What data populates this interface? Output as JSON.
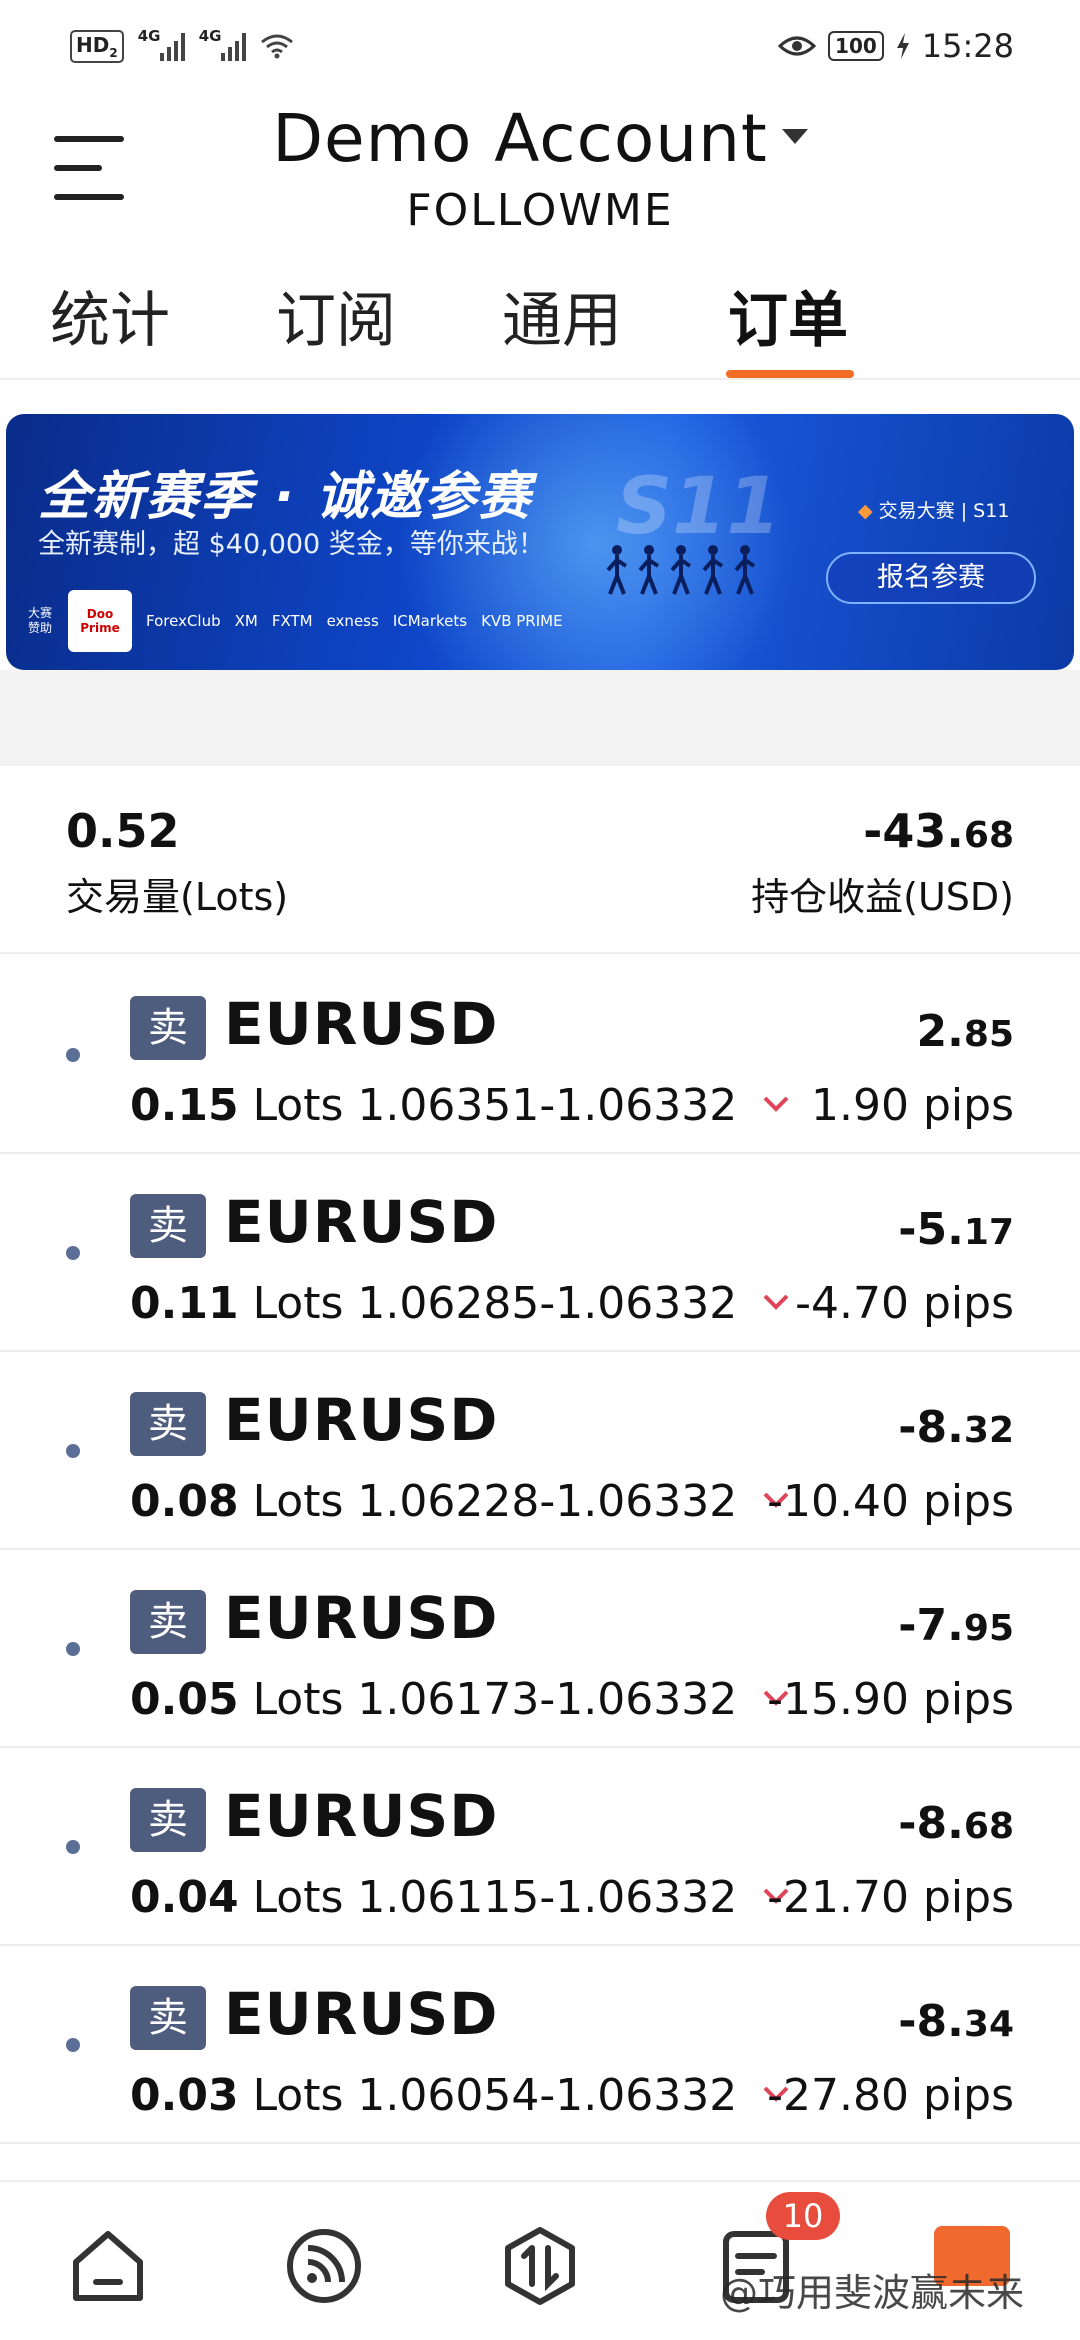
{
  "status_bar": {
    "hd": "HD",
    "hd_sub": "2",
    "network1": "4G",
    "network2": "4G",
    "battery": "100",
    "time": "15:28"
  },
  "header": {
    "account_title": "Demo Account",
    "account_sub": "FOLLOWME"
  },
  "tabs": [
    "统计",
    "订阅",
    "通用",
    "订单"
  ],
  "active_tab_index": 3,
  "banner": {
    "title": "全新赛季 · 诚邀参赛",
    "subtitle": "全新赛制，超 $40,000 奖金，等你来战！",
    "season": "S11",
    "brand": "交易大赛",
    "brand_season": "S11",
    "cta": "报名参赛",
    "sponsor_label": "大赛赞助",
    "sponsors": [
      "Doo Prime",
      "ForexClub",
      "XM",
      "FXTM",
      "exness",
      "ICMarkets",
      "KVB PRIME"
    ]
  },
  "summary": {
    "volume_value": "0.52",
    "volume_label": "交易量(Lots)",
    "pl_int": "-43.",
    "pl_dec": "68",
    "pl_label": "持仓收益(USD)"
  },
  "orders": [
    {
      "side": "卖",
      "symbol": "EURUSD",
      "pl_int": "2.",
      "pl_dec": "85",
      "lots": "0.15",
      "lots_unit": "Lots",
      "prices": "1.06351-1.06332",
      "pips": "1.90 pips"
    },
    {
      "side": "卖",
      "symbol": "EURUSD",
      "pl_int": "-5.",
      "pl_dec": "17",
      "lots": "0.11",
      "lots_unit": "Lots",
      "prices": "1.06285-1.06332",
      "pips": "-4.70 pips"
    },
    {
      "side": "卖",
      "symbol": "EURUSD",
      "pl_int": "-8.",
      "pl_dec": "32",
      "lots": "0.08",
      "lots_unit": "Lots",
      "prices": "1.06228-1.06332",
      "pips": "-10.40 pips"
    },
    {
      "side": "卖",
      "symbol": "EURUSD",
      "pl_int": "-7.",
      "pl_dec": "95",
      "lots": "0.05",
      "lots_unit": "Lots",
      "prices": "1.06173-1.06332",
      "pips": "-15.90 pips"
    },
    {
      "side": "卖",
      "symbol": "EURUSD",
      "pl_int": "-8.",
      "pl_dec": "68",
      "lots": "0.04",
      "lots_unit": "Lots",
      "prices": "1.06115-1.06332",
      "pips": "-21.70 pips"
    },
    {
      "side": "卖",
      "symbol": "EURUSD",
      "pl_int": "-8.",
      "pl_dec": "34",
      "lots": "0.03",
      "lots_unit": "Lots",
      "prices": "1.06054-1.06332",
      "pips": "-27.80 pips"
    }
  ],
  "bottom_nav": {
    "items": [
      "home-icon",
      "feed-icon",
      "trade-icon",
      "orders-icon",
      "profile-icon"
    ],
    "badge": "10",
    "watermark": "@巧用斐波赢未来"
  },
  "colors": {
    "accent": "#f26c23",
    "badge_red": "#e84c3d",
    "side_badge": "#4e5d7e",
    "down_arrow": "#e0445a"
  }
}
